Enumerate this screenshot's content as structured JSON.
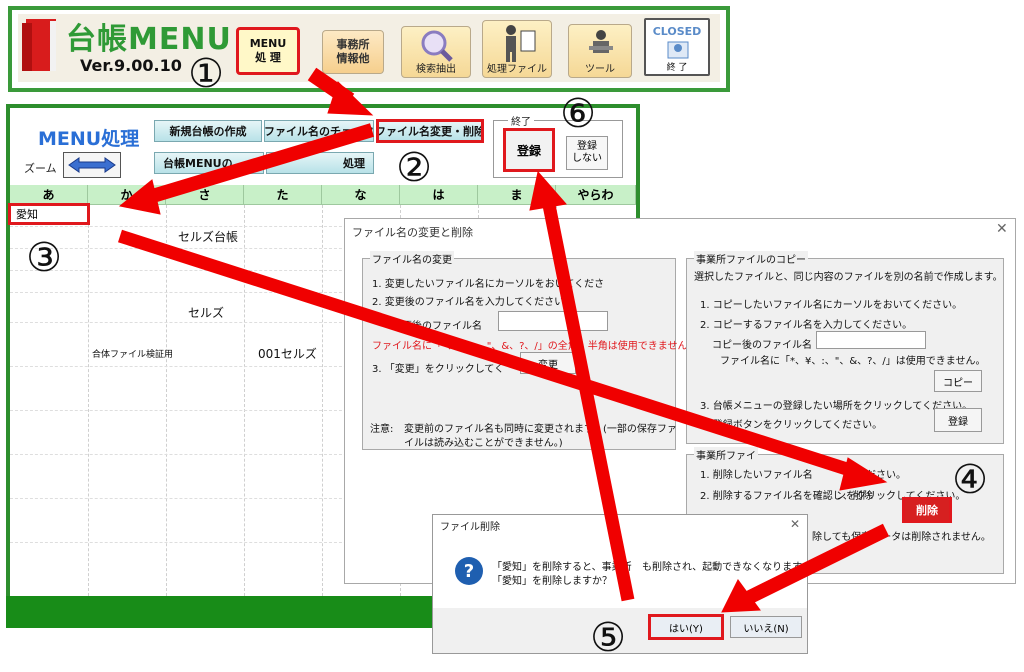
{
  "header": {
    "title": "台帳MENU",
    "version": "Ver.9.00.10",
    "buttons": {
      "menu_proc": "MENU\n処 理",
      "office_info": "事務所\n情報他",
      "search": "検索抽出",
      "ledger_file": "処理ファイル",
      "tools": "ツール",
      "closed": "CLOSED",
      "closed_sub": "終 了"
    }
  },
  "menu_panel": {
    "title": "MENU処理",
    "zoom_label": "ズーム",
    "buttons": {
      "new_ledger": "新規台帳の作成",
      "file_check": "ファイル名のチェック",
      "rename_delete": "ファイル名変更・削除",
      "menu_reorder": "台帳MENUの",
      "ab_sort": "処理"
    },
    "end_group": {
      "label": "終了",
      "register": "登録",
      "no_register": "登録\nしない"
    },
    "kana_columns": [
      "あ",
      "か",
      "さ",
      "た",
      "な",
      "は",
      "ま",
      "やらわ"
    ],
    "cells": {
      "aichi": "愛知",
      "seruzu_ledger": "セルズ台帳",
      "seruzu": "セルズ",
      "combined": "合体ファイル検証用",
      "seruzu_001": "001セルズ"
    }
  },
  "rename_dialog": {
    "title": "ファイル名の変更と削除",
    "rename": {
      "legend": "ファイル名の変更",
      "step1": "1. 変更したいファイル名にカーソルをおいてくださ",
      "step2": "2. 変更後のファイル名を入力してください。",
      "new_name_label": "変更後のファイル名",
      "warning": "ファイル名に「*、¥、:、\"、&、?、/」の全角、半角は使用できません。",
      "warning_prefix": "ファイル",
      "step3": "3. 「変更」をクリックしてく",
      "change_button": "変更",
      "note_label": "注意:",
      "note_text": "変更前のファイル名も同時に変更されます。(一部の保存ファ",
      "note_text2": "イルは読み込むことができません。)"
    },
    "copy": {
      "legend": "事業所ファイルのコピー",
      "intro": "選択したファイルと、同じ内容のファイルを別の名前で作成します。",
      "step1": "1. コピーしたいファイル名にカーソルをおいてください。",
      "step2": "2. コピーするファイル名を入力してください。",
      "copy_name_label": "コピー後のファイル名",
      "warning": "ファイル名に「*、¥、:、\"、&、?、/」は使用できません。",
      "copy_button": "コピー",
      "step3": "3. 台帳メニューの登録したい場所をクリックしてください。",
      "step4": "4. 登録ボタンをクリックしてください。",
      "register_button": "登録"
    },
    "delete": {
      "legend": "事業所ファイ",
      "step1": "1. 削除したいファイル名",
      "step1_tail": "ください。",
      "step2": "2. 削除するファイル名を確認し、削除",
      "step2_tail": "ンをクリックしてください。",
      "note_tail": "除しても保存データは削除されません。",
      "delete_button": "削除"
    }
  },
  "confirm_dialog": {
    "title": "ファイル削除",
    "message1": "「愛知」を削除すると、事業所",
    "message1_tail": "も削除され、起動できなくなります。",
    "message2": "「愛知」を削除しますか？",
    "yes": "はい(Y)",
    "no": "いいえ(N)"
  },
  "steps": [
    "①",
    "②",
    "③",
    "④",
    "⑤",
    "⑥"
  ],
  "colors": {
    "accent_red": "#e0181d",
    "frame_green": "#2d8e2d",
    "title_green": "#2f9a36",
    "menu_title_blue": "#2a6fd6"
  }
}
